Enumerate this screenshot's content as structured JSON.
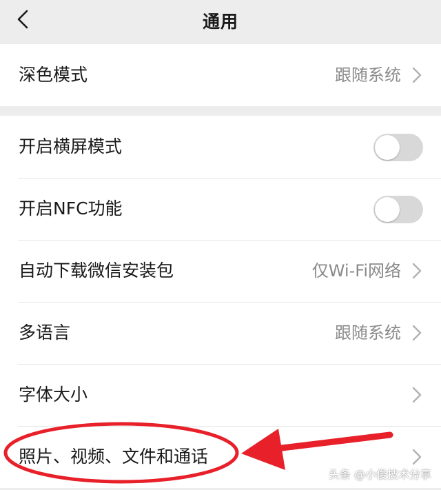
{
  "header": {
    "title": "通用",
    "back_icon": "chevron-left-icon"
  },
  "group1": [
    {
      "label": "深色模式",
      "value": "跟随系统"
    }
  ],
  "group2": [
    {
      "label": "开启横屏模式",
      "toggle": "off"
    },
    {
      "label": "开启NFC功能",
      "toggle": "off"
    },
    {
      "label": "自动下载微信安装包",
      "value": "仅Wi-Fi网络"
    },
    {
      "label": "多语言",
      "value": "跟随系统"
    },
    {
      "label": "字体大小",
      "value": ""
    },
    {
      "label": "照片、视频、文件和通话",
      "value": ""
    }
  ],
  "annotation": {
    "color": "#e8202a",
    "shapes": [
      "red-ellipse",
      "red-arrow"
    ]
  },
  "watermark": "头条 @小俊技术分享",
  "colors": {
    "background": "#ededed",
    "row": "#ffffff",
    "secondary_text": "#8a8a8a",
    "toggle_off": "#d8d8d8"
  }
}
